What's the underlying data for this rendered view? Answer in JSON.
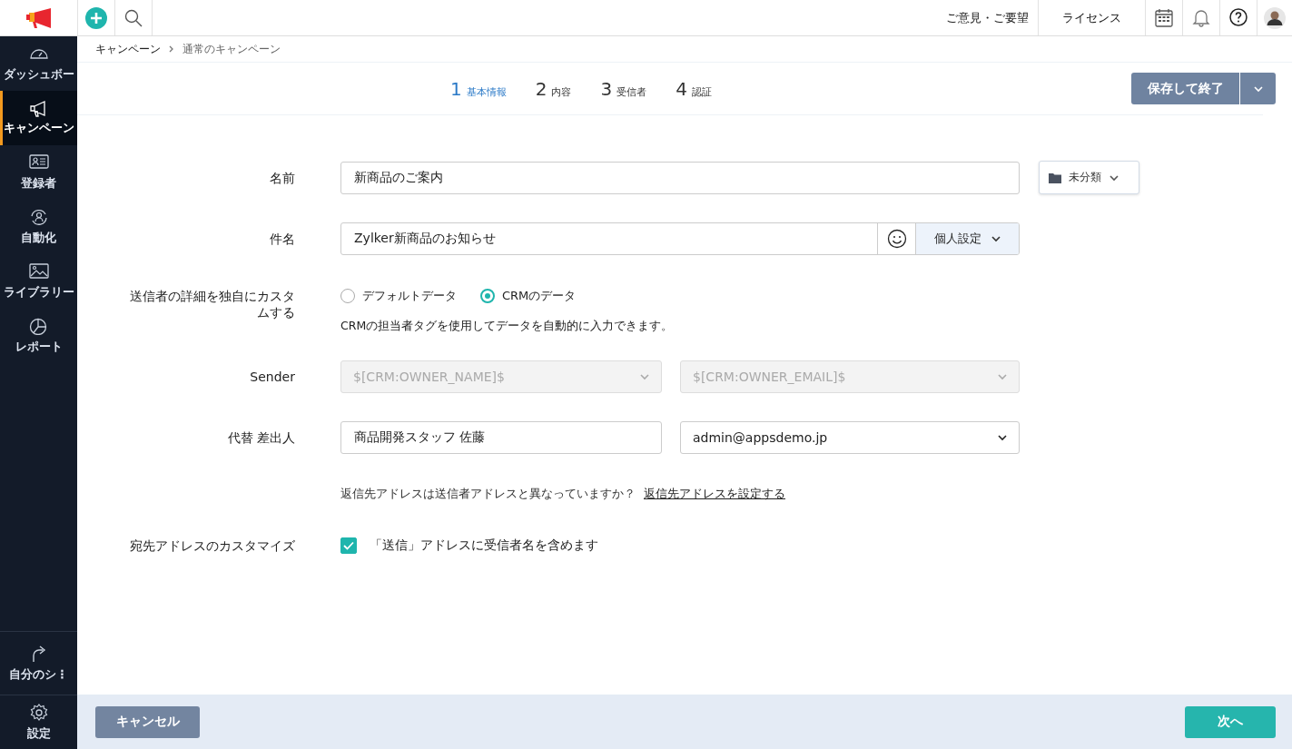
{
  "header": {
    "links": [
      {
        "label": "ご意見・ご要望"
      },
      {
        "label": "ライセンス"
      }
    ]
  },
  "sidebar": {
    "items": [
      {
        "label": "ダッシュボー",
        "selected": false
      },
      {
        "label": "キャンペーン",
        "selected": true
      },
      {
        "label": "登録者",
        "selected": false
      },
      {
        "label": "自動化",
        "selected": false
      },
      {
        "label": "ライブラリー",
        "selected": false
      },
      {
        "label": "レポート",
        "selected": false
      }
    ],
    "bottom_items": [
      {
        "label": "自分のシ⋮"
      },
      {
        "label": "設定"
      }
    ]
  },
  "breadcrumb": [
    "キャンペーン",
    "通常のキャンペーン"
  ],
  "steps": [
    {
      "number": "1",
      "label": "基本情報",
      "selected": true
    },
    {
      "number": "2",
      "label": "内容",
      "selected": false
    },
    {
      "number": "3",
      "label": "受信者",
      "selected": false
    },
    {
      "number": "4",
      "label": "認証",
      "selected": false
    }
  ],
  "save_button": "保存して終了",
  "form": {
    "rows": [
      {
        "kind": "name",
        "label": "名前",
        "value": "新商品のご案内",
        "folder": "未分類"
      },
      {
        "kind": "subject",
        "label": "件名",
        "value": "Zylker新商品のお知らせ",
        "personalize": "個人設定"
      },
      {
        "kind": "radio",
        "label": "送信者の詳細を独自にカスタムする",
        "options": [
          {
            "label": "デフォルトデータ",
            "selected": false
          },
          {
            "label": "CRMのデータ",
            "selected": true
          }
        ],
        "hint": "CRMの担当者タグを使用してデータを自動的に入力できます。"
      },
      {
        "kind": "selects",
        "label": "Sender",
        "selects": [
          {
            "value": "$[CRM:OWNER_NAME]$",
            "disabled": true
          },
          {
            "value": "$[CRM:OWNER_EMAIL]$",
            "disabled": true
          }
        ]
      },
      {
        "kind": "fields",
        "label": "代替 差出人",
        "name_value": "商品開発スタッフ 佐藤",
        "email_value": "admin@appsdemo.jp"
      },
      {
        "kind": "note",
        "text": "返信先アドレスは送信者アドレスと異なっていますか？",
        "link": "返信先アドレスを設定する"
      },
      {
        "kind": "checkbox",
        "label": "宛先アドレスのカスタマイズ",
        "option": "「送信」アドレスに受信者名を含めます",
        "checked": true
      }
    ]
  },
  "footer": {
    "cancel": "キャンセル",
    "next": "次へ"
  }
}
